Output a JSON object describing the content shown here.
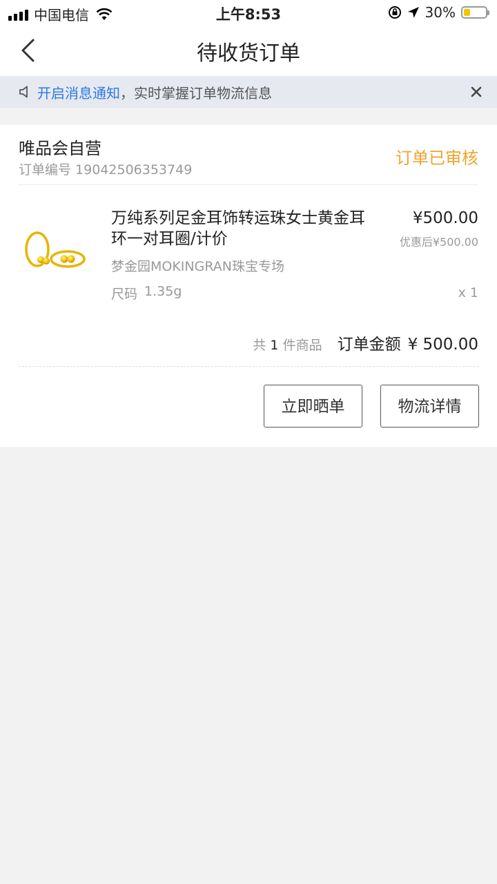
{
  "status_bar": {
    "carrier": "中国电信",
    "time": "上午8:53",
    "battery": "30%",
    "battery_level": 0.3
  },
  "nav": {
    "title": "待收货订单"
  },
  "notice": {
    "link": "开启消息通知",
    "text": "，实时掌握订单物流信息"
  },
  "order": {
    "store": "唯品会自营",
    "order_no": "订单编号 19042506353749",
    "status": "订单已审核",
    "status_color": "#f0a32a",
    "product": {
      "title": "万纯系列足金耳饰转运珠女士黄金耳环一对耳圈/计价",
      "price": "¥500.00",
      "promo": "优惠后¥500.00",
      "brand": "梦金园MOKINGRAN珠宝专场",
      "size_label": "尺码",
      "size_value": "1.35g",
      "qty": "x 1"
    },
    "summary": {
      "count_prefix": "共",
      "count": "1",
      "count_suffix": "件商品",
      "total_label": "订单金额",
      "total": "¥ 500.00"
    },
    "actions": {
      "review": "立即晒单",
      "logistics": "物流详情"
    }
  }
}
